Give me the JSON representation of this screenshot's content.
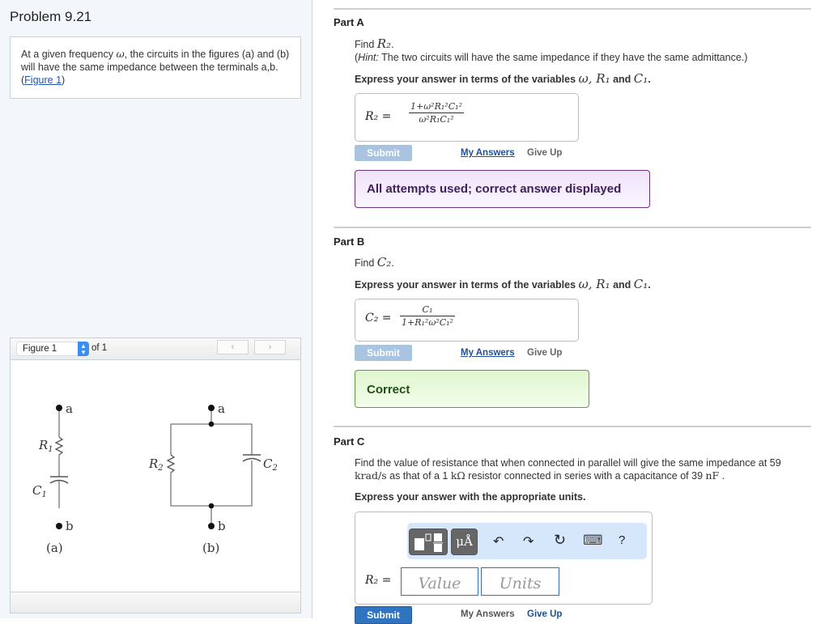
{
  "problem": {
    "title": "Problem 9.21",
    "text_before": "At a given frequency ",
    "omega": "ω",
    "text_after": ", the circuits in the figures (a) and (b) will have the same impedance between the terminals a,b. (",
    "figure_link": "Figure 1",
    "text_end": ")"
  },
  "figure_panel": {
    "select_value": "Figure 1",
    "of_label": "of 1",
    "prev_icon": "‹",
    "next_icon": "›",
    "circuit_a": {
      "terminal_top": "a",
      "terminal_bottom": "b",
      "resistor": "R",
      "resistor_sub": "1",
      "capacitor": "C",
      "capacitor_sub": "1",
      "caption": "(a)"
    },
    "circuit_b": {
      "terminal_top": "a",
      "terminal_bottom": "b",
      "resistor": "R",
      "resistor_sub": "2",
      "capacitor": "C",
      "capacitor_sub": "2",
      "caption": "(b)"
    }
  },
  "part_a": {
    "title": "Part A",
    "find_label": "Find ",
    "find_var": "R₂",
    "hint_word": "Hint:",
    "hint_text": " The two circuits will have the same impedance if they have the same admittance.)",
    "hint_open": "(",
    "express": "Express your answer in terms of the variables ",
    "vars": "ω, R₁",
    "and": " and ",
    "var_last": "C₁",
    "period": ".",
    "answer_label": "R₂ =",
    "numerator": "1+ω²R₁²C₁²",
    "denominator": "ω²R₁C₁²",
    "submit": "Submit",
    "my_answers": "My Answers",
    "give_up": "Give Up",
    "feedback": "All attempts used; correct answer displayed"
  },
  "part_b": {
    "title": "Part B",
    "find_label": "Find ",
    "find_var": "C₂",
    "express": "Express your answer in terms of the variables ",
    "vars": "ω, R₁",
    "and": " and ",
    "var_last": "C₁",
    "period": ".",
    "answer_label": "C₂ =",
    "numerator": "C₁",
    "denominator": "1+R₁²ω²C₁²",
    "submit": "Submit",
    "my_answers": "My Answers",
    "give_up": "Give Up",
    "feedback": "Correct"
  },
  "part_c": {
    "title": "Part C",
    "line1": "Find the value of resistance that when connected in parallel will give the same impedance at 59",
    "line2_unit1": "krad/s",
    "line2_a": " as that of a 1 ",
    "line2_unit2": "kΩ",
    "line2_b": " resistor connected in series with a capacitance of 39 ",
    "line2_unit3": "nF",
    "line2_end": " .",
    "express": "Express your answer with the appropriate units.",
    "toolbar": {
      "templates_icon": "templates-icon",
      "units_label": "μÅ",
      "undo_icon": "↶",
      "redo_icon": "↷",
      "reset_icon": "↻",
      "keyboard_icon": "⌨",
      "help_label": "?"
    },
    "answer_label": "R₂ =",
    "value_placeholder": "Value",
    "units_placeholder": "Units",
    "submit": "Submit",
    "my_answers": "My Answers",
    "give_up": "Give Up"
  }
}
